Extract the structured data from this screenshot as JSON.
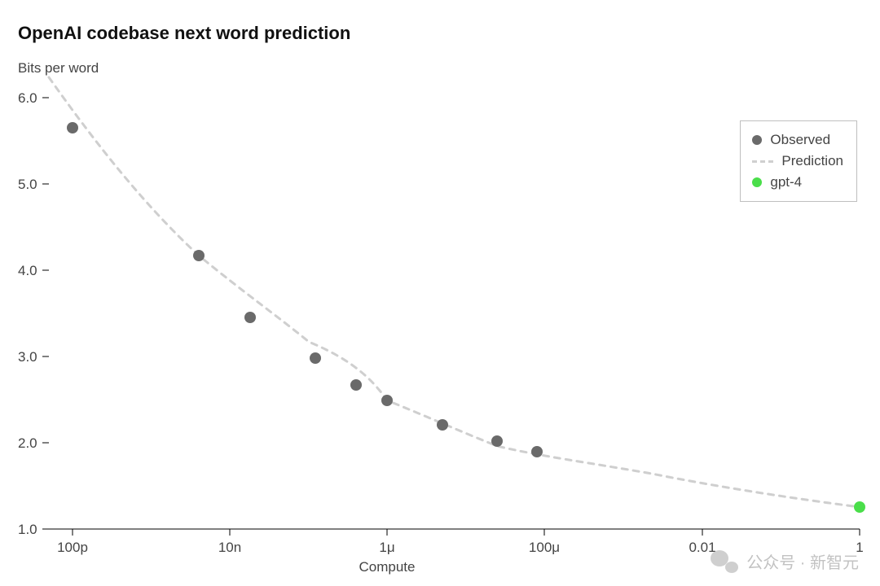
{
  "chart_data": {
    "type": "scatter",
    "title": "OpenAI codebase next word prediction",
    "ylabel": "Bits per word",
    "xlabel": "Compute",
    "ylim": [
      1.0,
      6.0
    ],
    "xlog_ticks": [
      {
        "value": 1e-10,
        "label": "100p"
      },
      {
        "value": 1e-08,
        "label": "10n"
      },
      {
        "value": 1e-06,
        "label": "1μ"
      },
      {
        "value": 0.0001,
        "label": "100μ"
      },
      {
        "value": 0.01,
        "label": "0.01"
      },
      {
        "value": 1,
        "label": "1"
      }
    ],
    "xrange_log10": [
      -10.3,
      0
    ],
    "yticks": [
      1.0,
      2.0,
      3.0,
      4.0,
      5.0,
      6.0
    ],
    "series": [
      {
        "name": "Observed",
        "kind": "point",
        "color": "#6a6a6a",
        "points": [
          {
            "x": 1e-10,
            "y": 5.65
          },
          {
            "x": 4e-09,
            "y": 4.17
          },
          {
            "x": 1.8e-08,
            "y": 3.45
          },
          {
            "x": 1.2e-07,
            "y": 2.98
          },
          {
            "x": 4e-07,
            "y": 2.67
          },
          {
            "x": 1e-06,
            "y": 2.49
          },
          {
            "x": 5e-06,
            "y": 2.21
          },
          {
            "x": 2.5e-05,
            "y": 2.02
          },
          {
            "x": 8e-05,
            "y": 1.9
          }
        ]
      },
      {
        "name": "Prediction",
        "kind": "dashed-line",
        "color": "#cfcfcf",
        "note": "smooth curve fit through observed points extending to x=1"
      },
      {
        "name": "gpt-4",
        "kind": "point",
        "color": "#4ade4a",
        "points": [
          {
            "x": 1.0,
            "y": 1.26
          }
        ]
      }
    ],
    "legend": [
      "Observed",
      "Prediction",
      "gpt-4"
    ],
    "watermark": "公众号 · 新智元"
  }
}
